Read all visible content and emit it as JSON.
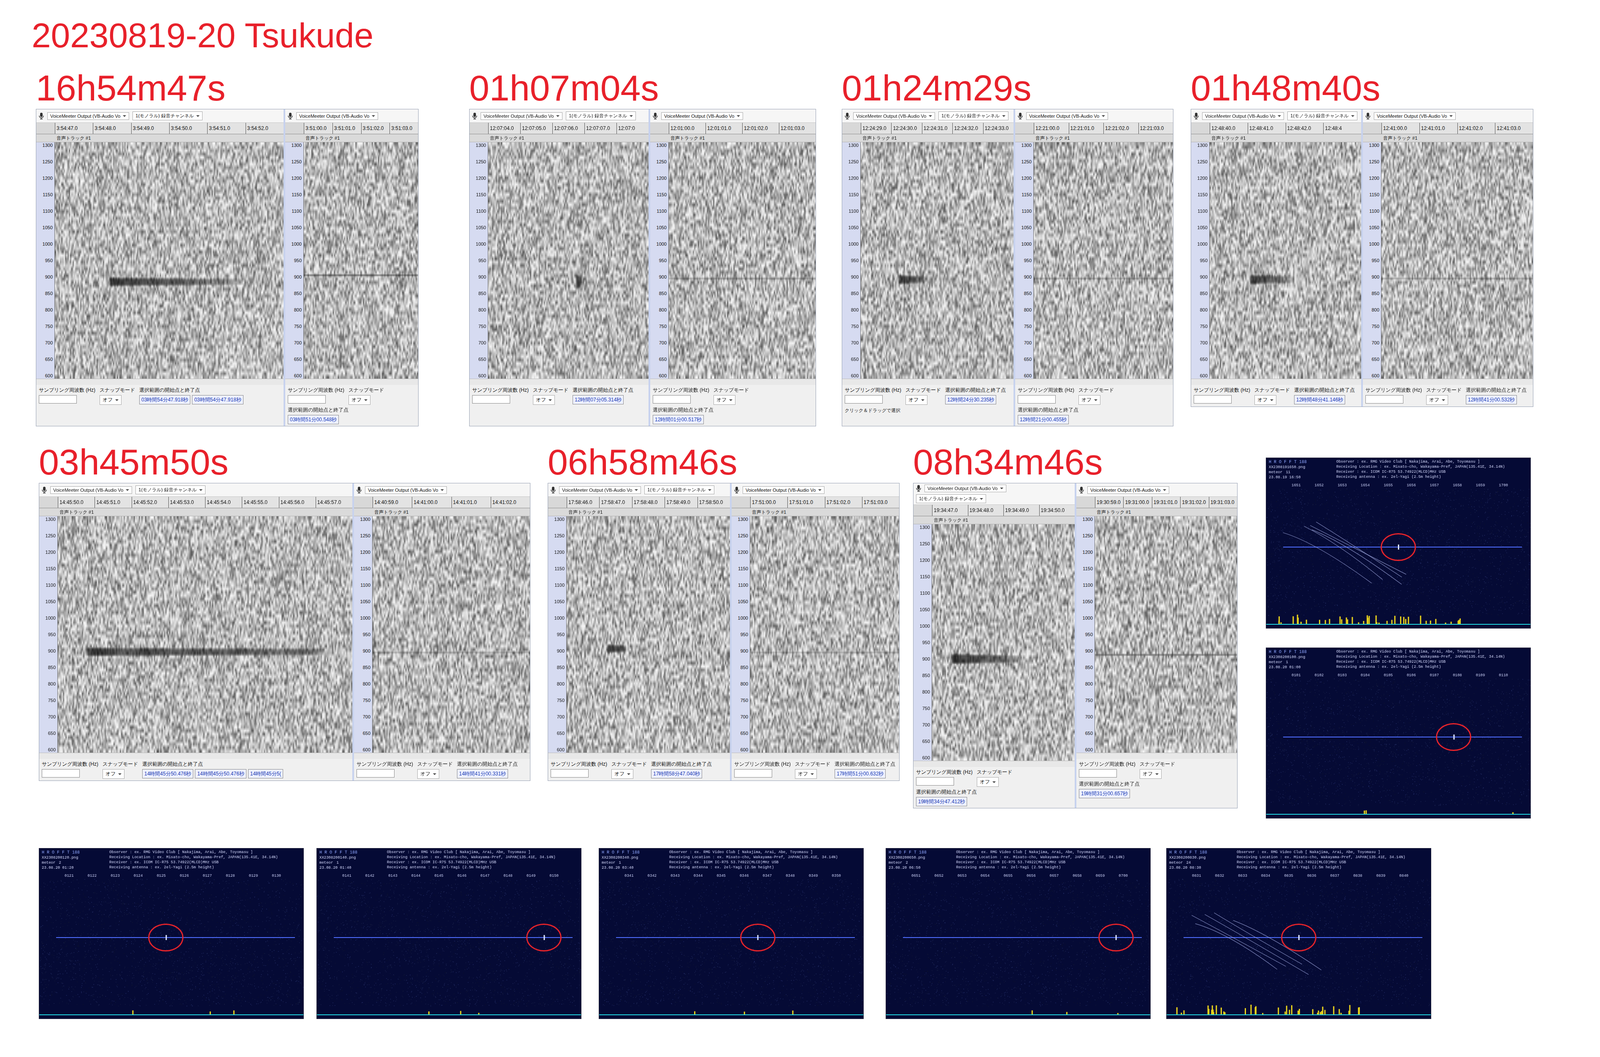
{
  "title": "20230819-20  Tsukude",
  "freq_ticks": [
    "1300",
    "1250",
    "1200",
    "1150",
    "1100",
    "1050",
    "1000",
    "950",
    "900",
    "850",
    "800",
    "750",
    "700",
    "650",
    "600"
  ],
  "toolbar": {
    "device": "VoiceMeeter Output (VB-Audio Vo",
    "channel": "1(モノラル) 録音チャンネル",
    "track": "音声トラック #1"
  },
  "status_labels": {
    "rate": "サンプリング周波数 (Hz)",
    "snap": "スナップモード",
    "selection": "選択範囲の開始点と終了点",
    "snap_value": "オフ"
  },
  "spectrograms": [
    {
      "label": "16h54m47s",
      "left": {
        "ticks": [
          "3:54:47.0",
          "3:54:48.0",
          "3:54:49.0",
          "3:54:50.0",
          "3:54:51.0",
          "3:54:52.0"
        ],
        "selection": [
          "03時間54分47.918秒",
          "03時間54分47.918秒"
        ],
        "echo": {
          "freq": 885,
          "band": 22,
          "start": 0.24,
          "end": 0.82,
          "strength": 0.95,
          "fade": 0.8,
          "ripple": 0
        }
      },
      "right": {
        "ticks": [
          "3:51:00.0",
          "3:51:01.0",
          "3:51:02.0",
          "3:51:03.0"
        ],
        "selection": [
          "03時間51分00.548秒"
        ],
        "carrier": {
          "freq": 905,
          "strength": 0.55
        }
      }
    },
    {
      "label": "01h07m04s",
      "left": {
        "ticks": [
          "12:07:04.0",
          "12:07:05.0",
          "12:07:06.0",
          "12:07:07.0",
          "12:07:0"
        ],
        "selection": [
          "12時間07分05.314秒"
        ],
        "echo": {
          "freq": 885,
          "band": 40,
          "start": 0.55,
          "end": 0.575,
          "strength": 0.95,
          "fade": 0.2,
          "ripple": 0
        }
      },
      "right": {
        "ticks": [
          "12:01:00.0",
          "12:01:01.0",
          "12:01:02.0",
          "12:01:03.0"
        ],
        "selection": [
          "12時間01分00.517秒"
        ],
        "carrier": {
          "freq": 895,
          "strength": 0.3
        }
      }
    },
    {
      "label": "01h24m29s",
      "left": {
        "ticks": [
          "12:24:29.0",
          "12:24:30.0",
          "12:24:31.0",
          "12:24:32.0",
          "12:24:33.0"
        ],
        "selection": [
          "12時間24分30.235秒"
        ],
        "hint": "クリック＆ドラッグで選択",
        "echo": {
          "freq": 892,
          "band": 24,
          "start": 0.25,
          "end": 0.42,
          "strength": 0.95,
          "fade": 0.7,
          "ripple": 0
        }
      },
      "right": {
        "ticks": [
          "12:21:00.0",
          "12:21:01.0",
          "12:21:02.0",
          "12:21:03.0"
        ],
        "selection": [
          "12時間21分00.455秒"
        ],
        "carrier": {
          "freq": 895,
          "strength": 0.3
        }
      }
    },
    {
      "label": "01h48m40s",
      "left": {
        "ticks": [
          "12:48:40.0",
          "12:48:41.0",
          "12:48:42.0",
          "12:48:4"
        ],
        "selection": [
          "12時間48分41.146秒"
        ],
        "echo": {
          "freq": 892,
          "band": 24,
          "start": 0.27,
          "end": 0.55,
          "strength": 0.95,
          "fade": 0.8,
          "ripple": 0
        }
      },
      "right": {
        "ticks": [
          "12:41:00.0",
          "12:41:01.0",
          "12:41:02.0",
          "12:41:03.0"
        ],
        "selection": [
          "12時間41分00.532秒"
        ],
        "carrier": {
          "freq": 895,
          "strength": 0.3
        }
      }
    },
    {
      "label": "03h45m50s",
      "left": {
        "ticks": [
          "14:45:50.0",
          "14:45:51.0",
          "14:45:52.0",
          "14:45:53.0",
          "14:45:54.0",
          "14:45:55.0",
          "14:45:56.0",
          "14:45:57.0"
        ],
        "selection": [
          "14時間45分50.476秒",
          "14時間45分50.476秒",
          "14時間45分5("
        ],
        "echo": {
          "freq": 897,
          "band": 22,
          "start": 0.1,
          "end": 0.9,
          "strength": 0.95,
          "fade": 0.55,
          "ripple": 0.25
        }
      },
      "right": {
        "ticks": [
          "14:40:59.0",
          "14:41:00.0",
          "14:41:01.0",
          "14:41:02.0"
        ],
        "selection": [
          "14時間41分00.331秒"
        ],
        "carrier": {
          "freq": 895,
          "strength": 0.25
        }
      }
    },
    {
      "label": "06h58m46s",
      "left": {
        "ticks": [
          "17:58:46.0",
          "17:58:47.0",
          "17:58:48.0",
          "17:58:49.0",
          "17:58:50.0"
        ],
        "selection": [
          "17時間58分47.040秒"
        ],
        "echo": {
          "freq": 907,
          "band": 22,
          "start": 0.25,
          "end": 0.36,
          "strength": 0.9,
          "fade": 0.3,
          "ripple": 0
        }
      },
      "right": {
        "ticks": [
          "17:51:00.0",
          "17:51:01.0",
          "17:51:02.0",
          "17:51:03.0"
        ],
        "selection": [
          "17時間51分00.632秒"
        ],
        "carrier": {
          "freq": 895,
          "strength": 0.25
        }
      }
    },
    {
      "label": "08h34m46s",
      "left": {
        "ticks": [
          "19:34:47.0",
          "19:34:48.0",
          "19:34:49.0",
          "19:34:50.0"
        ],
        "selection": [
          "19時間34分47.412秒"
        ],
        "echo": {
          "freq": 900,
          "band": 26,
          "start": 0.14,
          "end": 0.6,
          "strength": 0.95,
          "fade": 0.7,
          "ripple": 0
        }
      },
      "right": {
        "ticks": [
          "19:30:59.0",
          "19:31:00.0",
          "19:31:01.0",
          "19:31:02.0",
          "19:31:03.0"
        ],
        "selection": [
          "19時間31分00.657秒"
        ],
        "carrier": {
          "freq": 888,
          "strength": 0.45
        }
      }
    }
  ],
  "hrofft": {
    "brand": "H R O F F T 188",
    "meteor_word": "meteor",
    "observer_lines": [
      "Observer          : ex. RMG Video Club [ Nakajima, Arai, Abe, Toyomasu ]",
      "Receiving Location : ex. Misato-cho, Wakayama-Pref, JAPAN(135.41E, 34.14N)",
      "Receiver          : ex. ICOM IC-R75 53.74922(MLCD)MHz USB",
      "Receiving antenna : ex. 2el-Yagi (2.5m height)"
    ],
    "images": [
      {
        "file": "XX2308191650.png",
        "count": "11",
        "date": "23.08.19 16:50",
        "ticks": [
          "1651",
          "1652",
          "1653",
          "1654",
          "1655",
          "1656",
          "1657",
          "1658",
          "1659",
          "1700"
        ],
        "meteor_x": 0.5,
        "interference": true
      },
      {
        "file": "XX2308200100.png",
        "count": "1",
        "date": "23.08.20 01:00",
        "ticks": [
          "0101",
          "0102",
          "0103",
          "0104",
          "0105",
          "0106",
          "0107",
          "0108",
          "0109",
          "0110"
        ],
        "meteor_x": 0.71,
        "interference": false
      },
      {
        "file": "XX2308200120.png",
        "count": "2",
        "date": "23.08.20 01:20",
        "ticks": [
          "0121",
          "0122",
          "0123",
          "0124",
          "0125",
          "0126",
          "0127",
          "0128",
          "0129",
          "0130"
        ],
        "meteor_x": 0.48,
        "interference": false
      },
      {
        "file": "XX2308200140.png",
        "count": "1",
        "date": "23.08.20 01:40",
        "ticks": [
          "0141",
          "0142",
          "0143",
          "0144",
          "0145",
          "0146",
          "0147",
          "0148",
          "0149",
          "0150"
        ],
        "meteor_x": 0.86,
        "interference": false
      },
      {
        "file": "XX2308200340.png",
        "count": "1",
        "date": "23.08.20 03:40",
        "ticks": [
          "0341",
          "0342",
          "0343",
          "0344",
          "0345",
          "0346",
          "0347",
          "0348",
          "0349",
          "0350"
        ],
        "meteor_x": 0.6,
        "interference": false
      },
      {
        "file": "XX2308200650.png",
        "count": "2",
        "date": "23.08.20 06:50",
        "ticks": [
          "0651",
          "0652",
          "0653",
          "0654",
          "0655",
          "0656",
          "0657",
          "0658",
          "0659",
          "0700"
        ],
        "meteor_x": 0.87,
        "interference": false
      },
      {
        "file": "XX2308200830.png",
        "count": "24",
        "date": "23.08.20 08:30",
        "ticks": [
          "0831",
          "0832",
          "0833",
          "0834",
          "0835",
          "0836",
          "0837",
          "0838",
          "0839",
          "0840"
        ],
        "meteor_x": 0.5,
        "interference": true
      }
    ]
  }
}
